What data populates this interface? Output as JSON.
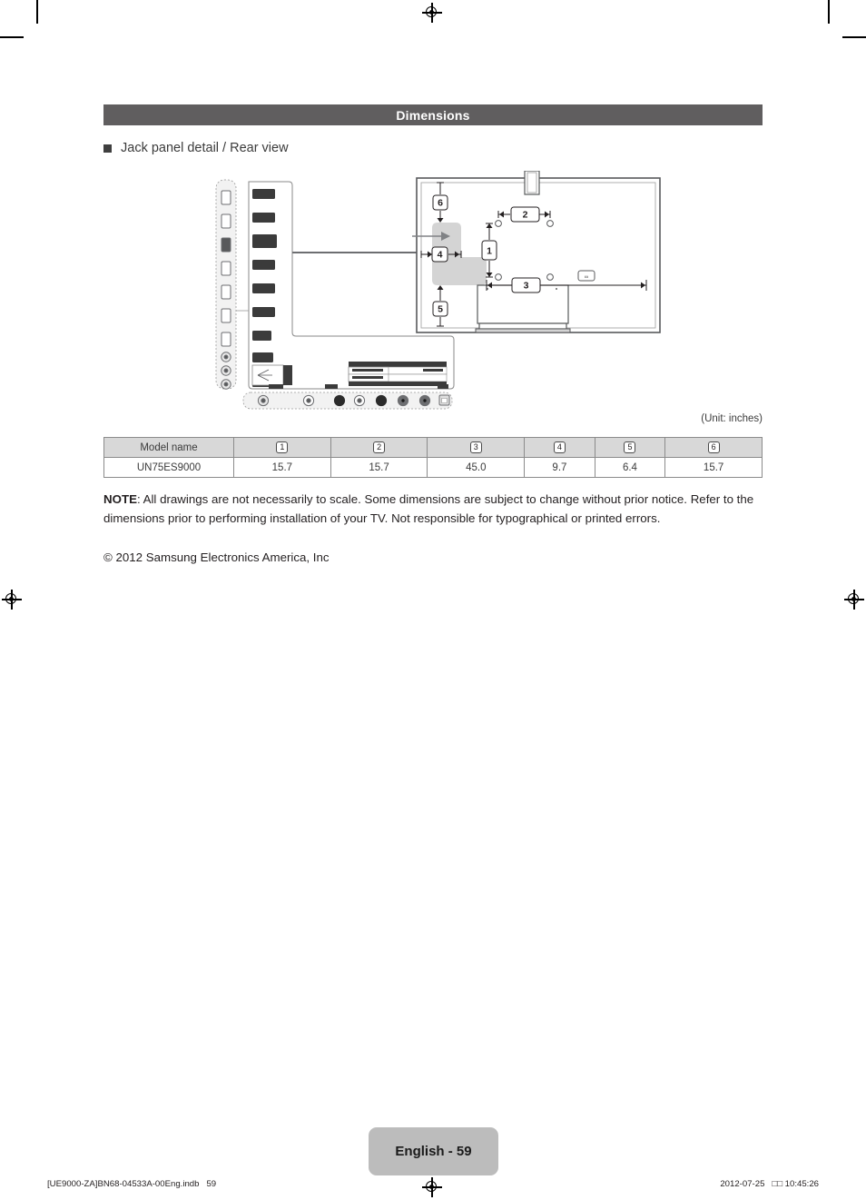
{
  "section": {
    "title": "Dimensions"
  },
  "heading": {
    "bullet_icon": "filled-square-bullet",
    "text": "Jack panel detail / Rear view"
  },
  "unit_note": "(Unit: inches)",
  "table": {
    "headers": [
      "Model name",
      "1",
      "2",
      "3",
      "4",
      "5",
      "6"
    ],
    "rows": [
      [
        "UN75ES9000",
        "15.7",
        "15.7",
        "45.0",
        "9.7",
        "6.4",
        "15.7"
      ]
    ]
  },
  "note": {
    "label": "NOTE",
    "body": ": All drawings are not necessarily to scale. Some dimensions are subject to change without prior notice. Refer to the dimensions prior to performing installation of your TV. Not responsible for typographical or printed errors."
  },
  "copyright": "© 2012 Samsung Electronics America, Inc",
  "footer": {
    "page_label": "English - 59",
    "file_info": "[UE9000-ZA]BN68-04533A-00Eng.indb   59",
    "timestamp": "2012-07-25   □□ 10:45:26"
  },
  "diagram": {
    "rear_view": {
      "callouts": [
        "1",
        "2",
        "3",
        "4",
        "5",
        "6"
      ],
      "jack_area_label": "jack-panel-region"
    },
    "jack_panel": {
      "side_ports_count": 7,
      "side_jacks_count": 3,
      "bottom_jacks_count": 7,
      "bottom_port_count": 1
    }
  },
  "colors": {
    "section_bar": "#605e5f",
    "table_header": "#d8d8d8",
    "page_tab": "#bcbcbc",
    "diagram_line": "#58595b",
    "jack_region_fill": "#d4d4d4"
  }
}
